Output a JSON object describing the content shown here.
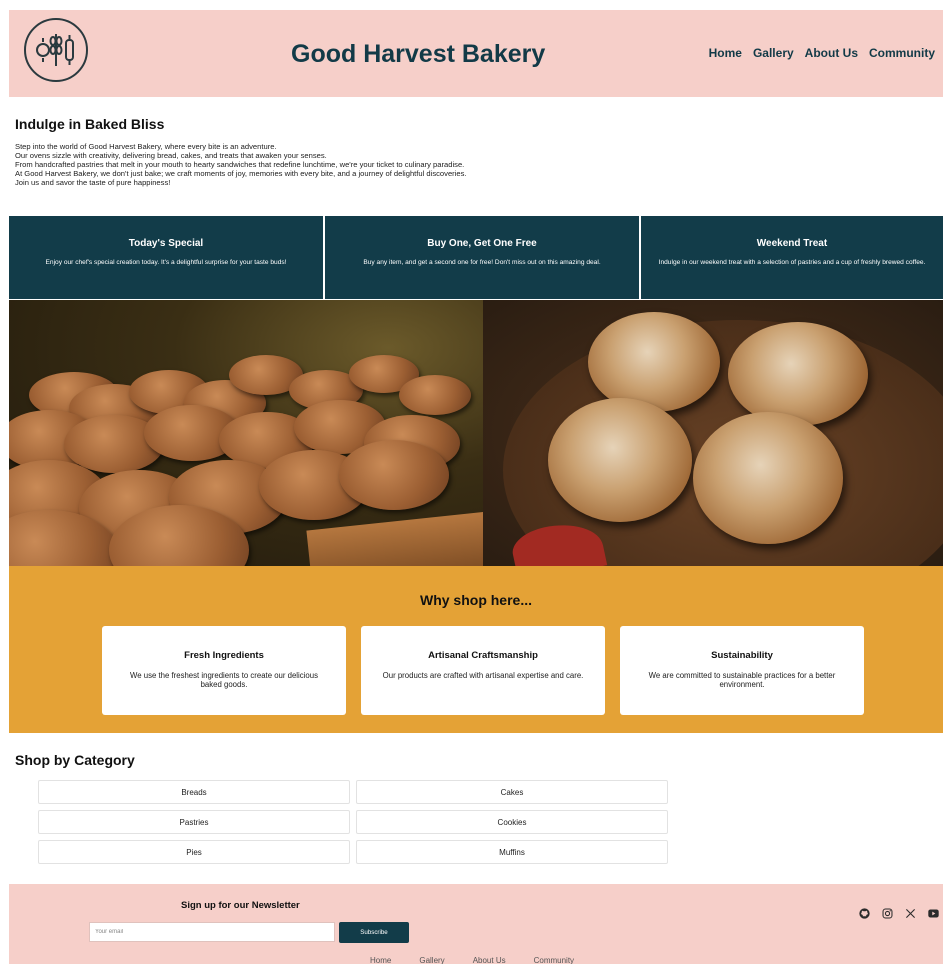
{
  "header": {
    "title": "Good Harvest Bakery",
    "nav": [
      "Home",
      "Gallery",
      "About Us",
      "Community"
    ]
  },
  "intro": {
    "title": "Indulge in Baked Bliss",
    "lines": [
      "Step into the world of Good Harvest Bakery, where every bite is an adventure.",
      "Our ovens sizzle with creativity, delivering bread, cakes, and treats that awaken your senses.",
      "From handcrafted pastries that melt in your mouth to hearty sandwiches that redefine lunchtime, we're your ticket to culinary paradise.",
      "At Good Harvest Bakery, we don't just bake; we craft moments of joy, memories with every bite, and a journey of delightful discoveries.",
      "Join us and savor the taste of pure happiness!"
    ]
  },
  "promos": [
    {
      "title": "Today's Special",
      "text": "Enjoy our chef's special creation today. It's a delightful surprise for your taste buds!"
    },
    {
      "title": "Buy One, Get One Free",
      "text": "Buy any item, and get a second one for free! Don't miss out on this amazing deal."
    },
    {
      "title": "Weekend Treat",
      "text": "Indulge in our weekend treat with a selection of pastries and a cup of freshly brewed coffee."
    }
  ],
  "why": {
    "title": "Why shop here...",
    "features": [
      {
        "title": "Fresh Ingredients",
        "text": "We use the freshest ingredients to create our delicious baked goods."
      },
      {
        "title": "Artisanal Craftsmanship",
        "text": "Our products are crafted with artisanal expertise and care."
      },
      {
        "title": "Sustainability",
        "text": "We are committed to sustainable practices for a better environment."
      }
    ]
  },
  "category": {
    "title": "Shop by Category",
    "items": [
      "Breads",
      "Cakes",
      "Pastries",
      "Cookies",
      "Pies",
      "Muffins"
    ]
  },
  "footer": {
    "newsletter_title": "Sign up for our Newsletter",
    "email_placeholder": "Your email",
    "subscribe_label": "Subscribe",
    "social_icons": [
      "github-icon",
      "instagram-icon",
      "x-icon",
      "youtube-icon"
    ],
    "nav": [
      "Home",
      "Gallery",
      "About Us",
      "Community"
    ]
  },
  "colors": {
    "header_bg": "#f6cfc9",
    "dark_teal": "#123c49",
    "why_bg": "#e4a236"
  }
}
